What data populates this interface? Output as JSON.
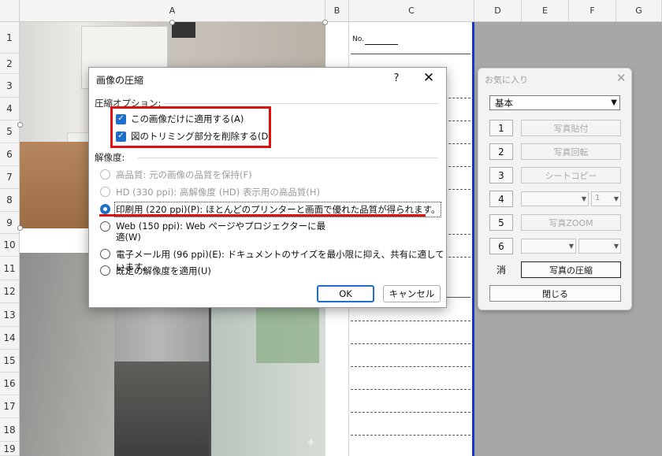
{
  "sheet": {
    "columns": [
      "A",
      "B",
      "C",
      "D",
      "E",
      "F",
      "G"
    ],
    "rows": [
      "1",
      "2",
      "3",
      "4",
      "5",
      "6",
      "7",
      "8",
      "9",
      "10",
      "11",
      "12",
      "13",
      "14",
      "15",
      "16",
      "17",
      "18",
      "19"
    ],
    "no_label": "No."
  },
  "dialog": {
    "title": "画像の圧縮",
    "help": "?",
    "close": "✕",
    "options_label": "圧縮オプション:",
    "checkboxes": [
      {
        "label": "この画像だけに適用する(A)",
        "checked": true
      },
      {
        "label": "図のトリミング部分を削除する(D)",
        "checked": true
      }
    ],
    "resolution_label": "解像度:",
    "radios": [
      {
        "label": "高品質: 元の画像の品質を保持(F)",
        "enabled": false,
        "checked": false
      },
      {
        "label": "HD (330 ppi): 高解像度 (HD) 表示用の高品質(H)",
        "enabled": false,
        "checked": false
      },
      {
        "label": "印刷用 (220 ppi)(P): ほとんどのプリンターと画面で優れた品質が得られます。",
        "enabled": true,
        "checked": true
      },
      {
        "label": "Web (150 ppi): Web ページやプロジェクターに最適(W)",
        "enabled": true,
        "checked": false
      },
      {
        "label": "電子メール用 (96 ppi)(E): ドキュメントのサイズを最小限に抑え、共有に適しています。",
        "enabled": true,
        "checked": false
      },
      {
        "label": "既定の解像度を適用(U)",
        "enabled": true,
        "checked": false
      }
    ],
    "ok": "OK",
    "cancel": "キャンセル"
  },
  "panel": {
    "title": "お気に入り",
    "close": "✕",
    "preset": "基本",
    "rows": [
      {
        "num": "1",
        "button": "写真貼付"
      },
      {
        "num": "2",
        "button": "写真回転"
      },
      {
        "num": "3",
        "button": "シートコピー"
      },
      {
        "num": "4",
        "spinner": "1"
      },
      {
        "num": "5",
        "button": "写真ZOOM"
      },
      {
        "num": "6"
      }
    ],
    "clear": "消",
    "compress": "写真の圧縮",
    "close_button": "閉じる"
  },
  "colors": {
    "accent": "#1f6ec9",
    "highlight": "#e01010",
    "sheet_border": "#1a35c9"
  }
}
